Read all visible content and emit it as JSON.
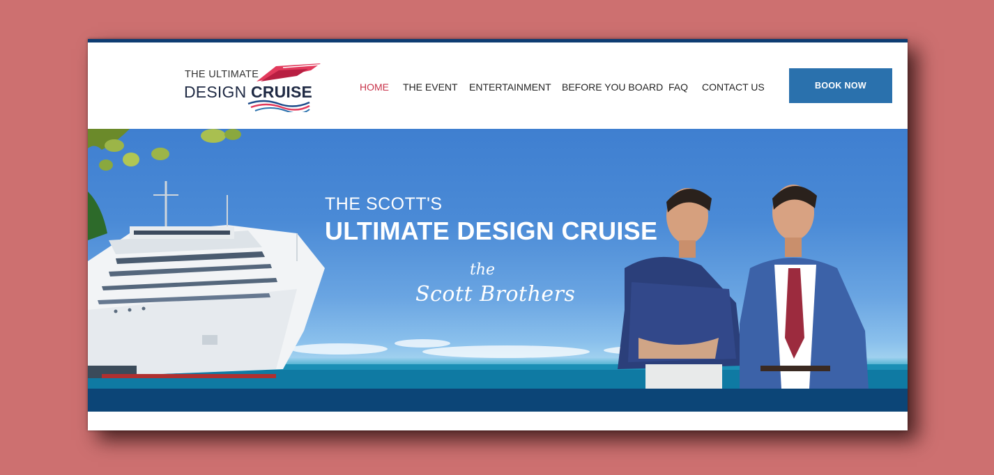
{
  "logo": {
    "line1": "THE ULTIMATE",
    "line2_regular": "DESIGN ",
    "line2_bold": "CRUISE"
  },
  "nav": {
    "items": [
      {
        "label": "HOME",
        "active": true
      },
      {
        "label": "THE EVENT",
        "active": false
      },
      {
        "label": "ENTERTAINMENT",
        "active": false
      },
      {
        "label": "BEFORE YOU BOARD",
        "active": false
      },
      {
        "label": "FAQ",
        "active": false
      },
      {
        "label": "CONTACT US",
        "active": false
      }
    ],
    "cta_label": "BOOK NOW"
  },
  "hero": {
    "line1": "THE SCOTT'S",
    "line2": "ULTIMATE DESIGN CRUISE",
    "signature_the": "the",
    "signature": "Scott Brothers"
  },
  "colors": {
    "page_background": "#cd7070",
    "brand_navy": "#0e3d72",
    "accent_red": "#c8334a",
    "button_blue": "#2a71ad",
    "band_blue": "#0c4577"
  }
}
